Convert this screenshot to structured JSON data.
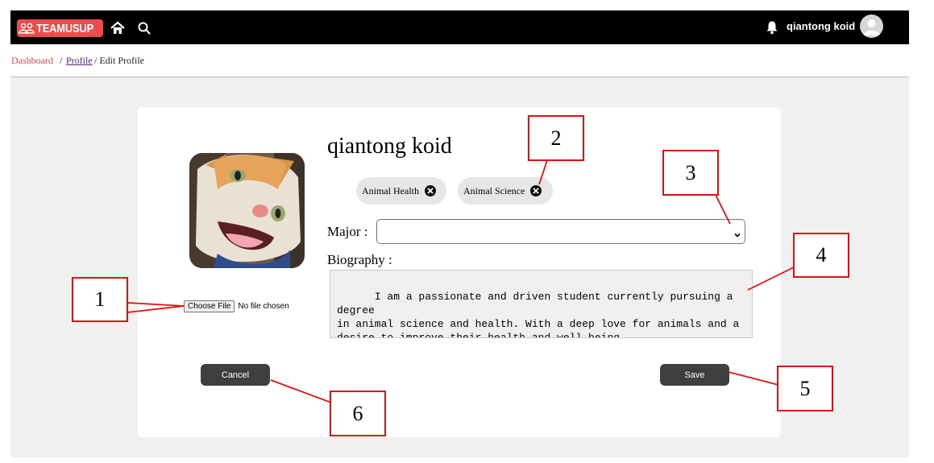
{
  "header": {
    "brand": "TEAMUSUP",
    "username": "qiantong koid",
    "icons": [
      "home-icon",
      "search-icon",
      "bell-icon",
      "user-avatar-icon"
    ]
  },
  "breadcrumb": {
    "dashboard": "Dashboard",
    "separator1": "/",
    "profile": "Profile",
    "separator2": "/ Edit Profile"
  },
  "profile": {
    "name": "qiantong koid",
    "file_button": "Choose File",
    "file_status": "No file chosen",
    "tags": [
      "Animal Health",
      "Animal Science"
    ],
    "major_label": "Major :",
    "major_value": "",
    "bio_label": "Biography :",
    "bio_text": "I am a passionate and driven student currently pursuing a degree\nin animal science and health. With a deep love for animals and a\ndesire to improve their health and well-being."
  },
  "actions": {
    "cancel": "Cancel",
    "save": "Save"
  },
  "annotations": [
    "1",
    "2",
    "3",
    "4",
    "5",
    "6"
  ],
  "colors": {
    "brand": "#ee4c4c",
    "annotation": "#e01010",
    "button": "#3f3f3f",
    "link_dashboard": "#e64545"
  }
}
